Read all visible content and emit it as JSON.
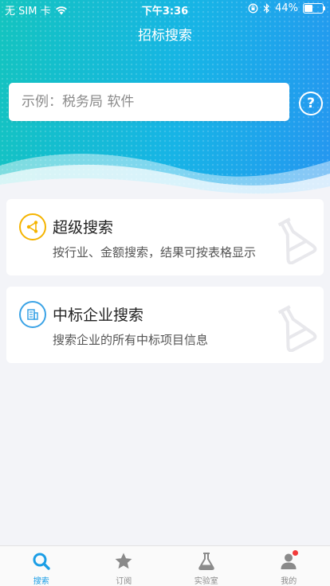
{
  "status_bar": {
    "carrier": "无 SIM 卡",
    "time": "下午3:36",
    "battery_percent": "44%",
    "battery_level": 0.44
  },
  "header": {
    "title": "招标搜索",
    "search_placeholder": "示例：税务局 软件"
  },
  "cards": [
    {
      "title": "超级搜索",
      "desc": "按行业、金额搜索，结果可按表格显示",
      "icon_color": "#f5b400"
    },
    {
      "title": "中标企业搜索",
      "desc": "搜索企业的所有中标项目信息",
      "icon_color": "#3ba3e6"
    }
  ],
  "tabs": [
    {
      "label": "搜索",
      "icon": "search-icon",
      "active": true
    },
    {
      "label": "订阅",
      "icon": "star-icon",
      "active": false
    },
    {
      "label": "实验室",
      "icon": "flask-icon",
      "active": false
    },
    {
      "label": "我的",
      "icon": "user-icon",
      "active": false
    }
  ],
  "colors": {
    "accent": "#1b9ee6",
    "inactive": "#8a8a8a",
    "badge": "#f23a3a"
  }
}
